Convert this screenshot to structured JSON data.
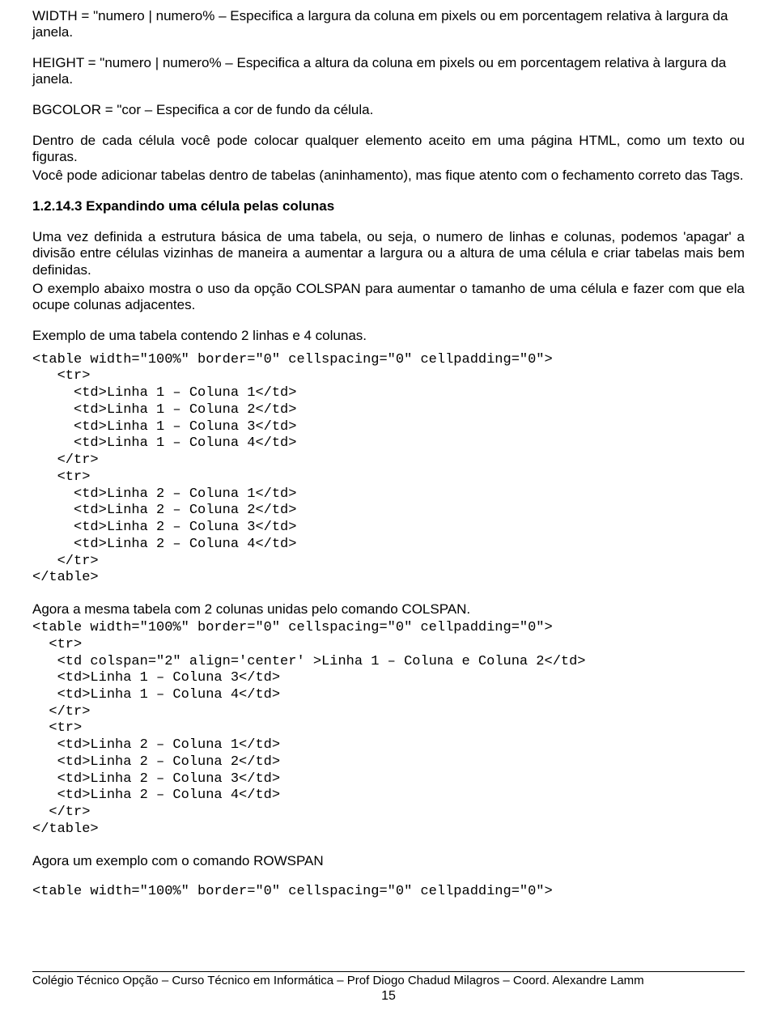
{
  "para": {
    "width_def": "WIDTH = \"numero | numero% – Especifica a largura da coluna em pixels ou em porcentagem relativa à largura da janela.",
    "height_def": "HEIGHT = \"numero | numero% – Especifica a altura da coluna em pixels ou em porcentagem relativa à largura da janela.",
    "bgcolor_def": "BGCOLOR = \"cor – Especifica a cor de fundo da célula.",
    "cell_p1": "Dentro de cada célula você pode colocar qualquer elemento aceito em uma página HTML, como um texto ou figuras.",
    "cell_p2": "Você pode adicionar tabelas dentro de tabelas (aninhamento), mas fique atento com o fechamento correto das Tags.",
    "heading": "1.2.14.3 Expandindo uma célula pelas colunas",
    "exp_p1": "Uma vez definida a estrutura básica de uma tabela, ou seja, o numero de linhas e colunas, podemos 'apagar' a divisão entre células vizinhas de maneira a aumentar a largura ou a altura de uma célula e criar tabelas mais bem definidas.",
    "exp_p2": "O exemplo abaixo mostra o uso da opção COLSPAN para aumentar o tamanho de uma célula e fazer com que ela ocupe colunas adjacentes.",
    "exemplo_intro": "Exemplo de uma tabela contendo 2 linhas e 4 colunas.",
    "colspan_intro": "Agora a mesma tabela com 2 colunas unidas pelo comando COLSPAN.",
    "rowspan_intro": "Agora um exemplo com o comando ROWSPAN"
  },
  "code": {
    "block1": "<table width=\"100%\" border=\"0\" cellspacing=\"0\" cellpadding=\"0\">\n   <tr>\n     <td>Linha 1 – Coluna 1</td>\n     <td>Linha 1 – Coluna 2</td>\n     <td>Linha 1 – Coluna 3</td>\n     <td>Linha 1 – Coluna 4</td>\n   </tr>\n   <tr>\n     <td>Linha 2 – Coluna 1</td>\n     <td>Linha 2 – Coluna 2</td>\n     <td>Linha 2 – Coluna 3</td>\n     <td>Linha 2 – Coluna 4</td>\n   </tr>\n</table>",
    "block2": "<table width=\"100%\" border=\"0\" cellspacing=\"0\" cellpadding=\"0\">\n  <tr>\n   <td colspan=\"2\" align='center' >Linha 1 – Coluna e Coluna 2</td>\n   <td>Linha 1 – Coluna 3</td>\n   <td>Linha 1 – Coluna 4</td>\n  </tr>\n  <tr>\n   <td>Linha 2 – Coluna 1</td>\n   <td>Linha 2 – Coluna 2</td>\n   <td>Linha 2 – Coluna 3</td>\n   <td>Linha 2 – Coluna 4</td>\n  </tr>\n</table>",
    "block3": "<table width=\"100%\" border=\"0\" cellspacing=\"0\" cellpadding=\"0\">"
  },
  "footer": {
    "line": "Colégio Técnico Opção – Curso Técnico em Informática – Prof Diogo Chadud Milagros – Coord. Alexandre Lamm",
    "page": "15"
  }
}
